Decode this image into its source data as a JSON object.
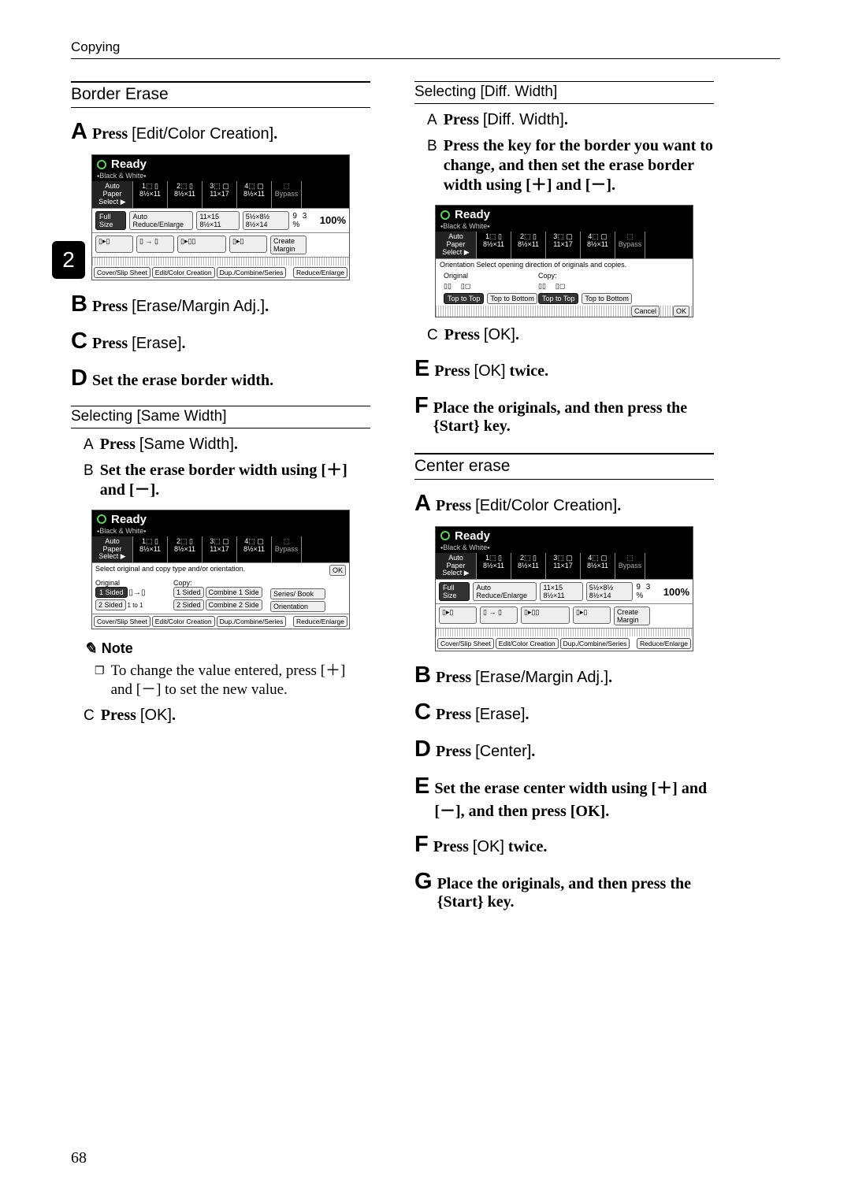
{
  "page": {
    "header": "Copying",
    "number": "68",
    "side_tab": "2"
  },
  "left": {
    "section": "Border Erase",
    "A": {
      "prefix": "Press ",
      "btn": "[Edit/Color Creation]",
      "suffix": "."
    },
    "B": {
      "prefix": "Press ",
      "btn": "[Erase/Margin Adj.]",
      "suffix": "."
    },
    "C": {
      "prefix": "Press ",
      "btn": "[Erase]",
      "suffix": "."
    },
    "D": "Set the erase border width.",
    "sub1": {
      "title": "Selecting [Same Width]",
      "a": {
        "prefix": "Press ",
        "btn": "[Same Width]",
        "suffix": "."
      },
      "b": "Set the erase border width using [＋] and [－]."
    },
    "note": {
      "label": "Note",
      "body": "To change the value entered, press [＋] and [－] to set the new value."
    },
    "cstep": {
      "letter": "C",
      "prefix": "Press ",
      "btn": "[OK]",
      "suffix": "."
    }
  },
  "right": {
    "sub2": {
      "title": "Selecting [Diff. Width]",
      "a": {
        "prefix": "Press ",
        "btn": "[Diff. Width]",
        "suffix": "."
      },
      "b": "Press the key for the border you want to change, and then set the erase border width using [＋] and [－]."
    },
    "csub": {
      "letter": "C",
      "prefix": "Press ",
      "btn": "[OK]",
      "suffix": "."
    },
    "E": {
      "prefix": "Press ",
      "btn": "[OK]",
      "suffix": " twice."
    },
    "F": "Place the originals, and then press the {Start} key.",
    "section2": "Center erase",
    "s2A": {
      "prefix": "Press ",
      "btn": "[Edit/Color Creation]",
      "suffix": "."
    },
    "s2B": {
      "prefix": "Press ",
      "btn": "[Erase/Margin Adj.]",
      "suffix": "."
    },
    "s2C": {
      "prefix": "Press ",
      "btn": "[Erase]",
      "suffix": "."
    },
    "s2D": {
      "prefix": "Press ",
      "btn": "[Center]",
      "suffix": "."
    },
    "s2E": "Set the erase center width using [＋] and [－], and then press [OK].",
    "s2F": {
      "prefix": "Press ",
      "btn": "[OK]",
      "suffix": " twice."
    },
    "s2G": "Place the originals, and then press the {Start} key."
  },
  "screens": {
    "ready": "Ready",
    "bw": "⬩Black & White⬩",
    "auto_paper": "Auto Paper\nSelect ▶",
    "trays": [
      "1⬚ ▯\n8½×11",
      "2⬚ ▯\n8½×11",
      "3⬚ ▢\n11×17",
      "4⬚ ▢\n8½×11"
    ],
    "bypass": "⬚\nBypass",
    "full_size": "Full Size",
    "auto_re": "Auto Reduce/Enlarge",
    "ratio1": "11×15\n8½×11",
    "ratio2": "5½×8½\n8½×14",
    "pct": "9 3 %",
    "hund": "100%",
    "create_margin": "Create\nMargin",
    "footer": [
      "Cover/Slip Sheet",
      "Edit/Color Creation",
      "Dup./Combine/Series",
      "Reduce/Enlarge"
    ],
    "orient_row": "Select original and copy type and/or orientation.",
    "ok": "OK",
    "original": "Original",
    "copy": "Copy:",
    "one_sided": "1 Sided",
    "two_sided": "2 Sided",
    "combine1": "Combine 1 Side",
    "combine2": "Combine 2 Side",
    "series_book": "Series/ Book",
    "orientation_btn": "Orientation",
    "one_to_one": "1 to 1",
    "orientation_sel": "Orientation        Select opening direction of originals and copies.",
    "top_to_top": "Top to Top",
    "top_to_bottom": "Top to Bottom",
    "cancel": "Cancel"
  }
}
